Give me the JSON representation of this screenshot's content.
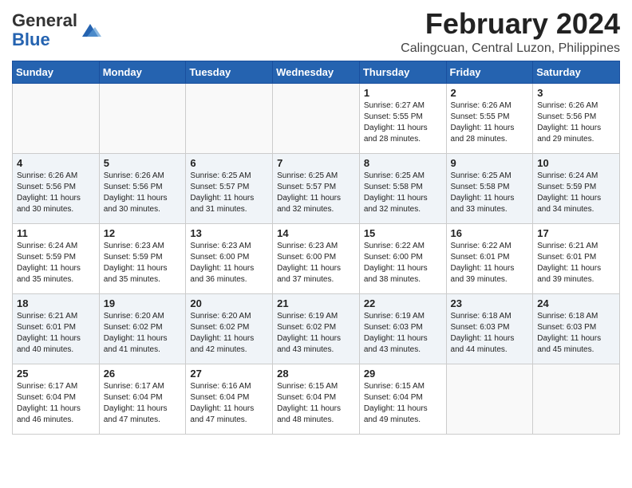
{
  "logo": {
    "general": "General",
    "blue": "Blue"
  },
  "title": "February 2024",
  "location": "Calingcuan, Central Luzon, Philippines",
  "days": [
    "Sunday",
    "Monday",
    "Tuesday",
    "Wednesday",
    "Thursday",
    "Friday",
    "Saturday"
  ],
  "weeks": [
    [
      {
        "day": "",
        "info": ""
      },
      {
        "day": "",
        "info": ""
      },
      {
        "day": "",
        "info": ""
      },
      {
        "day": "",
        "info": ""
      },
      {
        "day": "1",
        "info": "Sunrise: 6:27 AM\nSunset: 5:55 PM\nDaylight: 11 hours and 28 minutes."
      },
      {
        "day": "2",
        "info": "Sunrise: 6:26 AM\nSunset: 5:55 PM\nDaylight: 11 hours and 28 minutes."
      },
      {
        "day": "3",
        "info": "Sunrise: 6:26 AM\nSunset: 5:56 PM\nDaylight: 11 hours and 29 minutes."
      }
    ],
    [
      {
        "day": "4",
        "info": "Sunrise: 6:26 AM\nSunset: 5:56 PM\nDaylight: 11 hours and 30 minutes."
      },
      {
        "day": "5",
        "info": "Sunrise: 6:26 AM\nSunset: 5:56 PM\nDaylight: 11 hours and 30 minutes."
      },
      {
        "day": "6",
        "info": "Sunrise: 6:25 AM\nSunset: 5:57 PM\nDaylight: 11 hours and 31 minutes."
      },
      {
        "day": "7",
        "info": "Sunrise: 6:25 AM\nSunset: 5:57 PM\nDaylight: 11 hours and 32 minutes."
      },
      {
        "day": "8",
        "info": "Sunrise: 6:25 AM\nSunset: 5:58 PM\nDaylight: 11 hours and 32 minutes."
      },
      {
        "day": "9",
        "info": "Sunrise: 6:25 AM\nSunset: 5:58 PM\nDaylight: 11 hours and 33 minutes."
      },
      {
        "day": "10",
        "info": "Sunrise: 6:24 AM\nSunset: 5:59 PM\nDaylight: 11 hours and 34 minutes."
      }
    ],
    [
      {
        "day": "11",
        "info": "Sunrise: 6:24 AM\nSunset: 5:59 PM\nDaylight: 11 hours and 35 minutes."
      },
      {
        "day": "12",
        "info": "Sunrise: 6:23 AM\nSunset: 5:59 PM\nDaylight: 11 hours and 35 minutes."
      },
      {
        "day": "13",
        "info": "Sunrise: 6:23 AM\nSunset: 6:00 PM\nDaylight: 11 hours and 36 minutes."
      },
      {
        "day": "14",
        "info": "Sunrise: 6:23 AM\nSunset: 6:00 PM\nDaylight: 11 hours and 37 minutes."
      },
      {
        "day": "15",
        "info": "Sunrise: 6:22 AM\nSunset: 6:00 PM\nDaylight: 11 hours and 38 minutes."
      },
      {
        "day": "16",
        "info": "Sunrise: 6:22 AM\nSunset: 6:01 PM\nDaylight: 11 hours and 39 minutes."
      },
      {
        "day": "17",
        "info": "Sunrise: 6:21 AM\nSunset: 6:01 PM\nDaylight: 11 hours and 39 minutes."
      }
    ],
    [
      {
        "day": "18",
        "info": "Sunrise: 6:21 AM\nSunset: 6:01 PM\nDaylight: 11 hours and 40 minutes."
      },
      {
        "day": "19",
        "info": "Sunrise: 6:20 AM\nSunset: 6:02 PM\nDaylight: 11 hours and 41 minutes."
      },
      {
        "day": "20",
        "info": "Sunrise: 6:20 AM\nSunset: 6:02 PM\nDaylight: 11 hours and 42 minutes."
      },
      {
        "day": "21",
        "info": "Sunrise: 6:19 AM\nSunset: 6:02 PM\nDaylight: 11 hours and 43 minutes."
      },
      {
        "day": "22",
        "info": "Sunrise: 6:19 AM\nSunset: 6:03 PM\nDaylight: 11 hours and 43 minutes."
      },
      {
        "day": "23",
        "info": "Sunrise: 6:18 AM\nSunset: 6:03 PM\nDaylight: 11 hours and 44 minutes."
      },
      {
        "day": "24",
        "info": "Sunrise: 6:18 AM\nSunset: 6:03 PM\nDaylight: 11 hours and 45 minutes."
      }
    ],
    [
      {
        "day": "25",
        "info": "Sunrise: 6:17 AM\nSunset: 6:04 PM\nDaylight: 11 hours and 46 minutes."
      },
      {
        "day": "26",
        "info": "Sunrise: 6:17 AM\nSunset: 6:04 PM\nDaylight: 11 hours and 47 minutes."
      },
      {
        "day": "27",
        "info": "Sunrise: 6:16 AM\nSunset: 6:04 PM\nDaylight: 11 hours and 47 minutes."
      },
      {
        "day": "28",
        "info": "Sunrise: 6:15 AM\nSunset: 6:04 PM\nDaylight: 11 hours and 48 minutes."
      },
      {
        "day": "29",
        "info": "Sunrise: 6:15 AM\nSunset: 6:04 PM\nDaylight: 11 hours and 49 minutes."
      },
      {
        "day": "",
        "info": ""
      },
      {
        "day": "",
        "info": ""
      }
    ]
  ]
}
